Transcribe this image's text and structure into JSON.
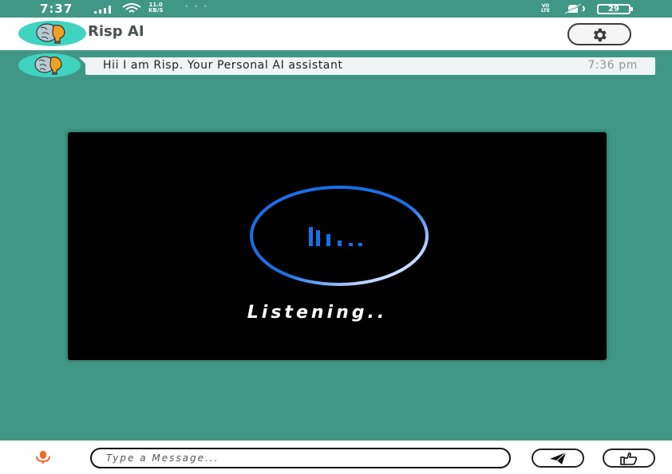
{
  "status_bar": {
    "time": "7:37",
    "net_speed_value": "11.0",
    "net_speed_unit": "KB/S",
    "more_dots": "· · ·",
    "volte_top": "VO",
    "volte_bottom": "LTE",
    "battery": "29"
  },
  "app_bar": {
    "title": "Risp AI",
    "logo_icon": "brain-bulb-icon",
    "settings_icon": "gear-icon"
  },
  "messages": [
    {
      "text": "Hii I am Risp. Your Personal AI assistant",
      "time": "7:36 pm"
    }
  ],
  "listening_dialog": {
    "status_text": "Listening..",
    "ring_colors": [
      "#1a6fe8",
      "#ffffff"
    ],
    "bars_color": "#1a6fe8"
  },
  "bottom_bar": {
    "input_placeholder": "Type a Message...",
    "input_value": "",
    "mic_icon": "microphone-icon",
    "send_icon": "send-icon",
    "like_icon": "thumbs-up-icon"
  },
  "colors": {
    "background": "#419785",
    "avatar": "#3fd3c0",
    "bulb": "#f0a020",
    "mic": "#f06a28"
  }
}
